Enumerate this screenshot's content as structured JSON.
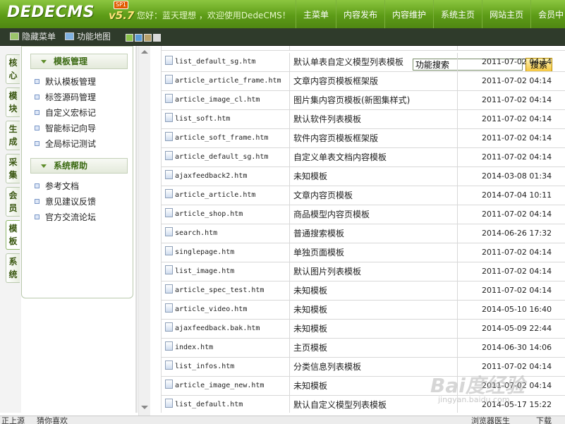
{
  "header": {
    "logo": "DEDECMS",
    "version": "v5.7",
    "edition": "SP1",
    "greeting": "您好：蓝天理想 ，欢迎使用DedeCMS！",
    "nav": [
      "主菜单",
      "内容发布",
      "内容维护",
      "系统主页",
      "网站主页",
      "会员中"
    ]
  },
  "toolbar": {
    "hide_menu": "隐藏菜单",
    "function_map": "功能地图",
    "search_value": "功能搜索",
    "search_button": "搜索",
    "skin_colors": [
      "#8bc34a",
      "#5b9bd5",
      "#b8a06a",
      "#d9d9d9"
    ]
  },
  "left_tabs": [
    "核心",
    "模块",
    "生成",
    "采集",
    "会员",
    "模板",
    "系统"
  ],
  "active_tab": "模板",
  "sidebar": {
    "sections": [
      {
        "title": "模板管理",
        "items": [
          "默认模板管理",
          "标签源码管理",
          "自定义宏标记",
          "智能标记向导",
          "全局标记测试"
        ]
      },
      {
        "title": "系统帮助",
        "items": [
          "参考文档",
          "意见建议反馈",
          "官方交流论坛"
        ]
      }
    ]
  },
  "files": [
    {
      "name": "list_default_sg.htm",
      "desc": "默认单表自定义模型列表模板",
      "date": "2011-07-02 04:14"
    },
    {
      "name": "article_article_frame.htm",
      "desc": "文章内容页模板框架版",
      "date": "2011-07-02 04:14"
    },
    {
      "name": "article_image_cl.htm",
      "desc": "图片集内容页模板(新图集样式)",
      "date": "2011-07-02 04:14"
    },
    {
      "name": "list_soft.htm",
      "desc": "默认软件列表模板",
      "date": "2011-07-02 04:14"
    },
    {
      "name": "article_soft_frame.htm",
      "desc": "软件内容页模板框架版",
      "date": "2011-07-02 04:14"
    },
    {
      "name": "article_default_sg.htm",
      "desc": "自定义单表文档内容模板",
      "date": "2011-07-02 04:14"
    },
    {
      "name": "ajaxfeedback2.htm",
      "desc": "未知模板",
      "date": "2014-03-08 01:34"
    },
    {
      "name": "article_article.htm",
      "desc": "文章内容页模板",
      "date": "2014-07-04 10:11"
    },
    {
      "name": "article_shop.htm",
      "desc": "商品模型内容页模板",
      "date": "2011-07-02 04:14"
    },
    {
      "name": "search.htm",
      "desc": "普通搜索模板",
      "date": "2014-06-26 17:32"
    },
    {
      "name": "singlepage.htm",
      "desc": "单独页面模板",
      "date": "2011-07-02 04:14"
    },
    {
      "name": "list_image.htm",
      "desc": "默认图片列表模板",
      "date": "2011-07-02 04:14"
    },
    {
      "name": "article_spec_test.htm",
      "desc": "未知模板",
      "date": "2011-07-02 04:14"
    },
    {
      "name": "article_video.htm",
      "desc": "未知模板",
      "date": "2014-05-10 16:40"
    },
    {
      "name": "ajaxfeedback.bak.htm",
      "desc": "未知模板",
      "date": "2014-05-09 22:44"
    },
    {
      "name": "index.htm",
      "desc": "主页模板",
      "date": "2014-06-30 14:06"
    },
    {
      "name": "list_infos.htm",
      "desc": "分类信息列表模板",
      "date": "2011-07-02 04:14"
    },
    {
      "name": "article_image_new.htm",
      "desc": "未知模板",
      "date": "2011-07-02 04:14"
    },
    {
      "name": "list_default.htm",
      "desc": "默认自定义模型列表模板",
      "date": "2014-05-17 15:22"
    }
  ],
  "statusbar": {
    "left": "正上源",
    "center": "猜你喜欢",
    "right1": "浏览器医生",
    "right2": "下载"
  },
  "watermark": {
    "main": "Bai度经验",
    "sub": "jingyan.baidu.com"
  }
}
